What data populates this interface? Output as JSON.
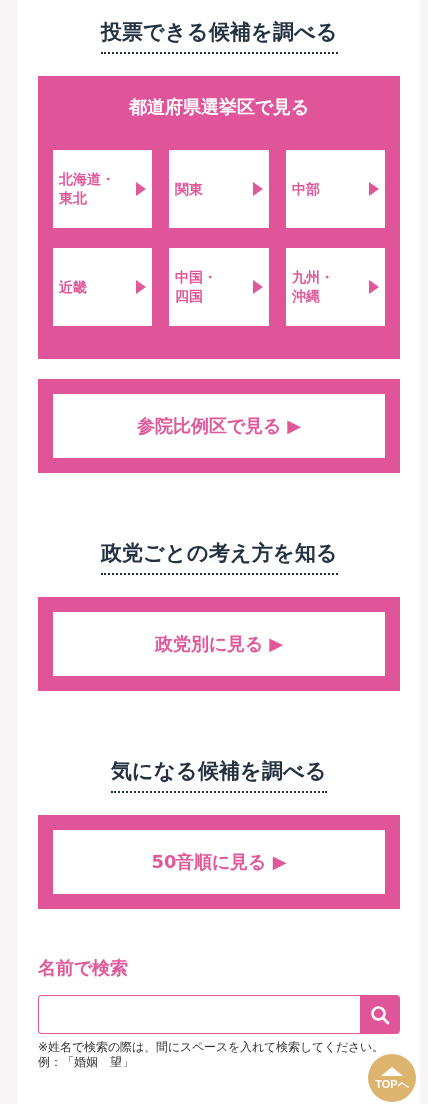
{
  "sections": [
    {
      "heading": "投票できる候補を調べる",
      "kind": "regions",
      "panel_title": "都道府県選挙区で見る",
      "regions": [
        [
          "北海道・",
          "東北"
        ],
        [
          "関東"
        ],
        [
          "中部"
        ],
        [
          "近畿"
        ],
        [
          "中国・",
          "四国"
        ],
        [
          "九州・",
          "沖縄"
        ]
      ],
      "button": "参院比例区で見る ▶"
    },
    {
      "heading": "政党ごとの考え方を知る",
      "kind": "button",
      "button": "政党別に見る ▶"
    },
    {
      "heading": "気になる候補を調べる",
      "kind": "button",
      "button": "50音順に見る ▶"
    }
  ],
  "search": {
    "title": "名前で検索",
    "notes": [
      "※姓名で検索の際は、間にスペースを入れて検索してください。",
      "例：「婚姻　望」"
    ]
  },
  "top_button": "TOPへ"
}
